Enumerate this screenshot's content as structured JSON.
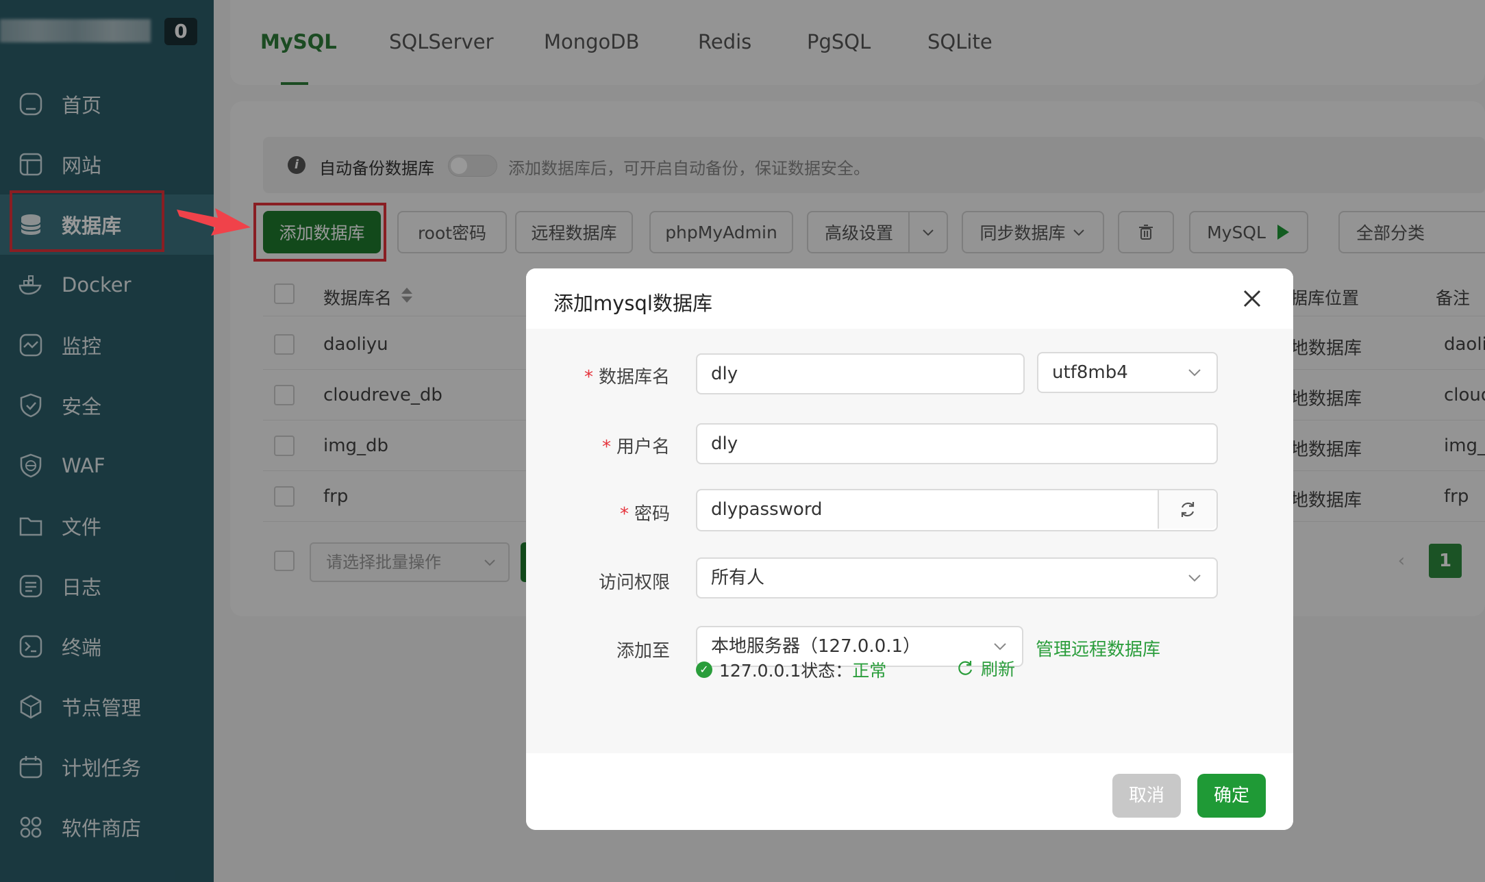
{
  "sidebar": {
    "badge_count": "0",
    "items": [
      {
        "label": "首页",
        "icon": "home-icon"
      },
      {
        "label": "网站",
        "icon": "website-icon"
      },
      {
        "label": "数据库",
        "icon": "database-icon",
        "active": true
      },
      {
        "label": "Docker",
        "icon": "docker-icon"
      },
      {
        "label": "监控",
        "icon": "monitor-icon"
      },
      {
        "label": "安全",
        "icon": "shield-icon"
      },
      {
        "label": "WAF",
        "icon": "waf-icon"
      },
      {
        "label": "文件",
        "icon": "folder-icon"
      },
      {
        "label": "日志",
        "icon": "log-icon"
      },
      {
        "label": "终端",
        "icon": "terminal-icon"
      },
      {
        "label": "节点管理",
        "icon": "node-icon"
      },
      {
        "label": "计划任务",
        "icon": "calendar-icon"
      },
      {
        "label": "软件商店",
        "icon": "apps-icon"
      }
    ]
  },
  "tabs": [
    "MySQL",
    "SQLServer",
    "MongoDB",
    "Redis",
    "PgSQL",
    "SQLite"
  ],
  "info_bar": {
    "label": "自动备份数据库",
    "hint": "添加数据库后，可开启自动备份，保证数据安全。"
  },
  "toolbar": {
    "add": "添加数据库",
    "root_pwd": "root密码",
    "remote": "远程数据库",
    "phpmyadmin": "phpMyAdmin",
    "advanced": "高级设置",
    "sync": "同步数据库",
    "mysql": "MySQL",
    "category": "全部分类"
  },
  "table": {
    "headers": {
      "name": "数据库名",
      "location": "据库位置",
      "remark": "备注"
    },
    "rows": [
      {
        "name": "daoliyu",
        "location": "地数据库",
        "remark": "daoli"
      },
      {
        "name": "cloudreve_db",
        "location": "地数据库",
        "remark": "cloud"
      },
      {
        "name": "img_db",
        "location": "地数据库",
        "remark": "img_"
      },
      {
        "name": "frp",
        "location": "地数据库",
        "remark": "frp"
      }
    ],
    "batch_placeholder": "请选择批量操作",
    "page": "1"
  },
  "dialog": {
    "title": "添加mysql数据库",
    "labels": {
      "db_name": "数据库名",
      "username": "用户名",
      "password": "密码",
      "access": "访问权限",
      "add_to": "添加至"
    },
    "values": {
      "db_name": "dly",
      "charset": "utf8mb4",
      "username": "dly",
      "password": "dlypassword",
      "access": "所有人",
      "server": "本地服务器（127.0.0.1）"
    },
    "manage_remote": "管理远程数据库",
    "status_prefix": "127.0.0.1状态：",
    "status_value": "正常",
    "refresh": "刷新",
    "cancel": "取消",
    "confirm": "确定"
  },
  "colors": {
    "sidebar_bg": "#2c5e6a",
    "primary_green": "#1e7a2e",
    "highlight_red": "#e5323b"
  }
}
